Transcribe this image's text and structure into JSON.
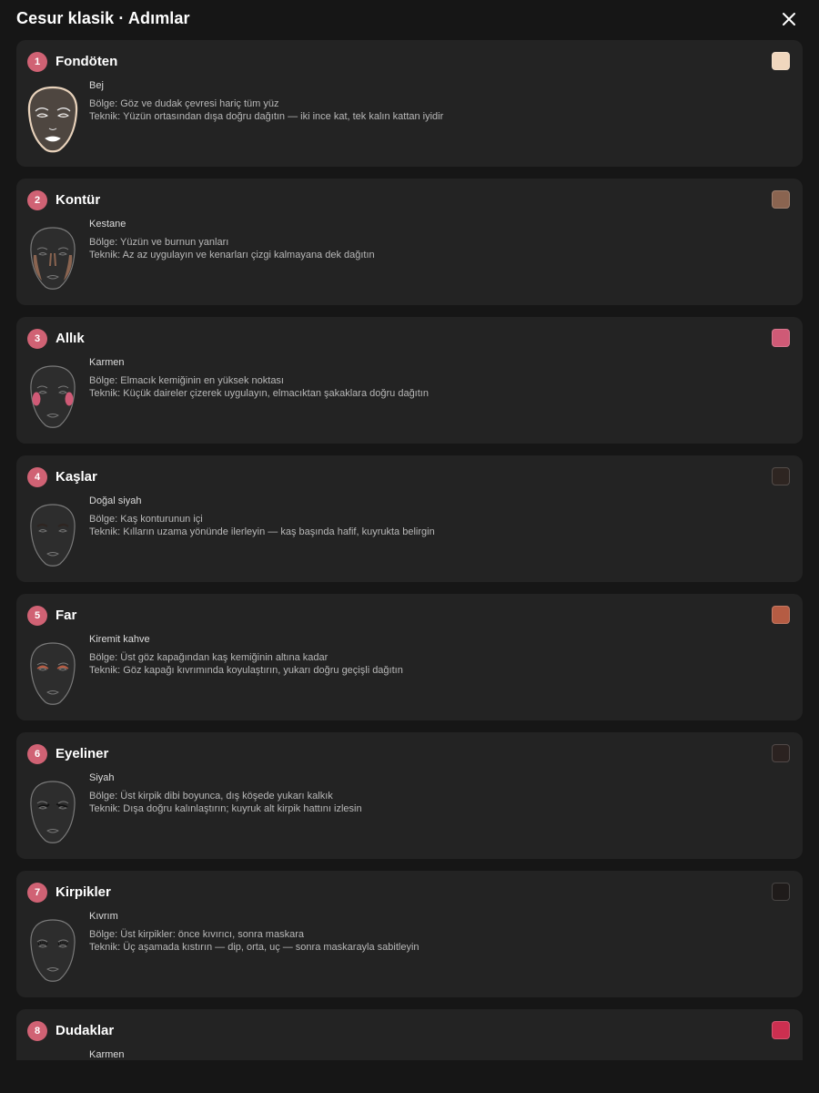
{
  "header": {
    "title": "Cesur klasik · Adımlar"
  },
  "steps": [
    {
      "number": "1",
      "title": "Fondöten",
      "shade": "Bej",
      "zone": "Bölge: Göz ve dudak çevresi hariç tüm yüz",
      "technique": "Teknik: Yüzün ortasından dışa doğru dağıtın — iki ince kat, tek kalın kattan iyidir",
      "swatch_color": "#f0d7be"
    },
    {
      "number": "2",
      "title": "Kontür",
      "shade": "Kestane",
      "zone": "Bölge: Yüzün ve burnun yanları",
      "technique": "Teknik: Az az uygulayın ve kenarları çizgi kalmayana dek dağıtın",
      "swatch_color": "#8a6450"
    },
    {
      "number": "3",
      "title": "Allık",
      "shade": "Karmen",
      "zone": "Bölge: Elmacık kemiğinin en yüksek noktası",
      "technique": "Teknik: Küçük daireler çizerek uygulayın, elmacıktan şakaklara doğru dağıtın",
      "swatch_color": "#cf5a76"
    },
    {
      "number": "4",
      "title": "Kaşlar",
      "shade": "Doğal siyah",
      "zone": "Bölge: Kaş konturunun içi",
      "technique": "Teknik: Kılların uzama yönünde ilerleyin — kaş başında hafif, kuyrukta belirgin",
      "swatch_color": "#2e2521"
    },
    {
      "number": "5",
      "title": "Far",
      "shade": "Kiremit kahve",
      "zone": "Bölge: Üst göz kapağından kaş kemiğinin altına kadar",
      "technique": "Teknik: Göz kapağı kıvrımında koyulaştırın, yukarı doğru geçişli dağıtın",
      "swatch_color": "#b55c43"
    },
    {
      "number": "6",
      "title": "Eyeliner",
      "shade": "Siyah",
      "zone": "Bölge: Üst kirpik dibi boyunca, dış köşede yukarı kalkık",
      "technique": "Teknik: Dışa doğru kalınlaştırın; kuyruk alt kirpik hattını izlesin",
      "swatch_color": "#2b2220"
    },
    {
      "number": "7",
      "title": "Kirpikler",
      "shade": "Kıvrım",
      "zone": "Bölge: Üst kirpikler: önce kıvırıcı, sonra maskara",
      "technique": "Teknik: Üç aşamada kıstırın — dip, orta, uç — sonra maskarayla sabitleyin",
      "swatch_color": "#1f1b1a"
    },
    {
      "number": "8",
      "title": "Dudaklar",
      "shade": "Karmen",
      "zone": "",
      "technique": "",
      "swatch_color": "#cc2f50"
    }
  ]
}
